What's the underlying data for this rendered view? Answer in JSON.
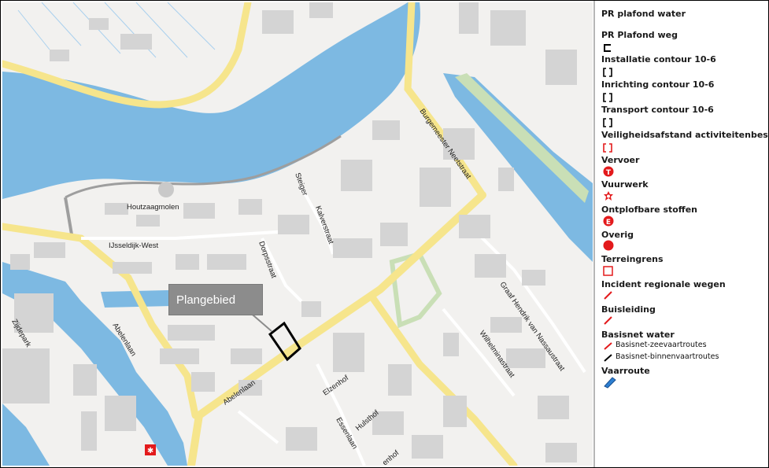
{
  "map": {
    "callout_label": "Plangebied",
    "street_labels": {
      "burgemeester": "Burgemeester Neetstraat",
      "steiger": "Steiger",
      "houtzaagmolen": "Houtzaagmolen",
      "kalverstraat": "Kalverstraat",
      "ijsseldijk": "IJsseldijk-West",
      "dorpsstraat": "Dorpsstraat",
      "zijdepark": "Zijdepark",
      "abelenlaan_1": "Abelenlaan",
      "abelenlaan_2": "Abelenlaan",
      "graaf": "Graaf Hendrik van Nassaustraat",
      "wilhelmina": "Wilhelminastraat",
      "elzenhof": "Elzenhof",
      "hulsthof": "Hulsthof",
      "essenlaan": "Essenlaan",
      "enhof": "enhof"
    },
    "colors": {
      "water": "#7db9e2",
      "road": "#f6e58c",
      "building": "#d4d4d4",
      "green": "#c9dfb6",
      "plan": "#000000",
      "risk": "#e31a1c"
    },
    "icons": [
      "plangebied-outline",
      "vuurwerk-risk-icon"
    ]
  },
  "legend": {
    "items": [
      {
        "title": "PR plafond water"
      },
      {
        "title": "PR Plafond weg",
        "symbol": "black-bracket-icon"
      },
      {
        "title": "Installatie contour 10-6",
        "symbol": "bracket-icon"
      },
      {
        "title": "Inrichting contour 10-6",
        "symbol": "bracket-icon"
      },
      {
        "title": "Transport contour 10-6",
        "symbol": "bracket-icon"
      },
      {
        "title": "Veiligheidsafstand activiteitenbesluit",
        "symbol": "red-bracket-icon"
      },
      {
        "title": "Vervoer",
        "symbol": "T",
        "color": "#e31a1c"
      },
      {
        "title": "Vuurwerk",
        "symbol": "star-icon",
        "color": "#e31a1c"
      },
      {
        "title": "Ontplofbare stoffen",
        "symbol": "E",
        "color": "#e31a1c"
      },
      {
        "title": "Overig",
        "symbol": "red-dot-icon",
        "color": "#e31a1c"
      },
      {
        "title": "Terreingrens",
        "symbol": "red-square-outline-icon"
      },
      {
        "title": "Incident regionale wegen",
        "symbol": "red-line-icon"
      },
      {
        "title": "Buisleiding",
        "symbol": "red-line-icon"
      },
      {
        "title": "Basisnet water",
        "subitems": [
          "Basisnet-zeevaartroutes",
          "Basisnet-binnenvaartroutes"
        ]
      },
      {
        "title": "Vaarroute",
        "symbol": "blue-route-icon",
        "color": "#2d7fd1"
      }
    ]
  }
}
